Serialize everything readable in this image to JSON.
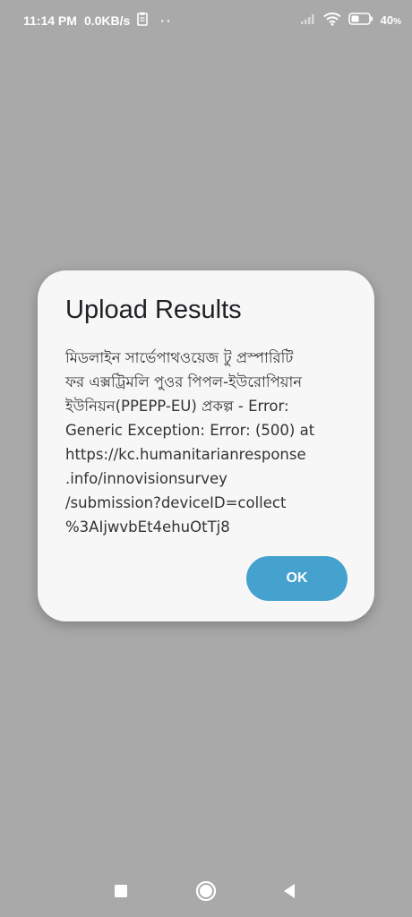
{
  "status_bar": {
    "time": "11:14 PM",
    "network_speed": "0.0KB/s",
    "notification_icons": [
      "clipboard-icon",
      "more-notifications-icon"
    ],
    "right_icons": [
      "signal-icon",
      "wifi-icon",
      "battery-icon"
    ],
    "battery_percent": "40",
    "battery_symbol": "%"
  },
  "dialog": {
    "title": "Upload Results",
    "message_lines": [
      "মিডলাইন সার্ভেপাথওয়েজ টু প্রস্পারিটি",
      "ফর এক্সট্রিমলি পুওর পিপল-ইউরোপিয়ান",
      "ইউনিয়ন(PPEPP-EU) প্রকল্প - Error:",
      "Generic Exception: Error:  (500) at",
      "https://kc.humanitarianresponse",
      ".info/innovisionsurvey",
      "/submission?deviceID=collect",
      "%3AIjwvbEt4ehuOtTj8"
    ],
    "ok_label": "OK",
    "accent_color": "#45a1cd"
  },
  "nav_bar": {
    "buttons": [
      "recents-square-icon",
      "home-circle-icon",
      "back-triangle-icon"
    ]
  }
}
